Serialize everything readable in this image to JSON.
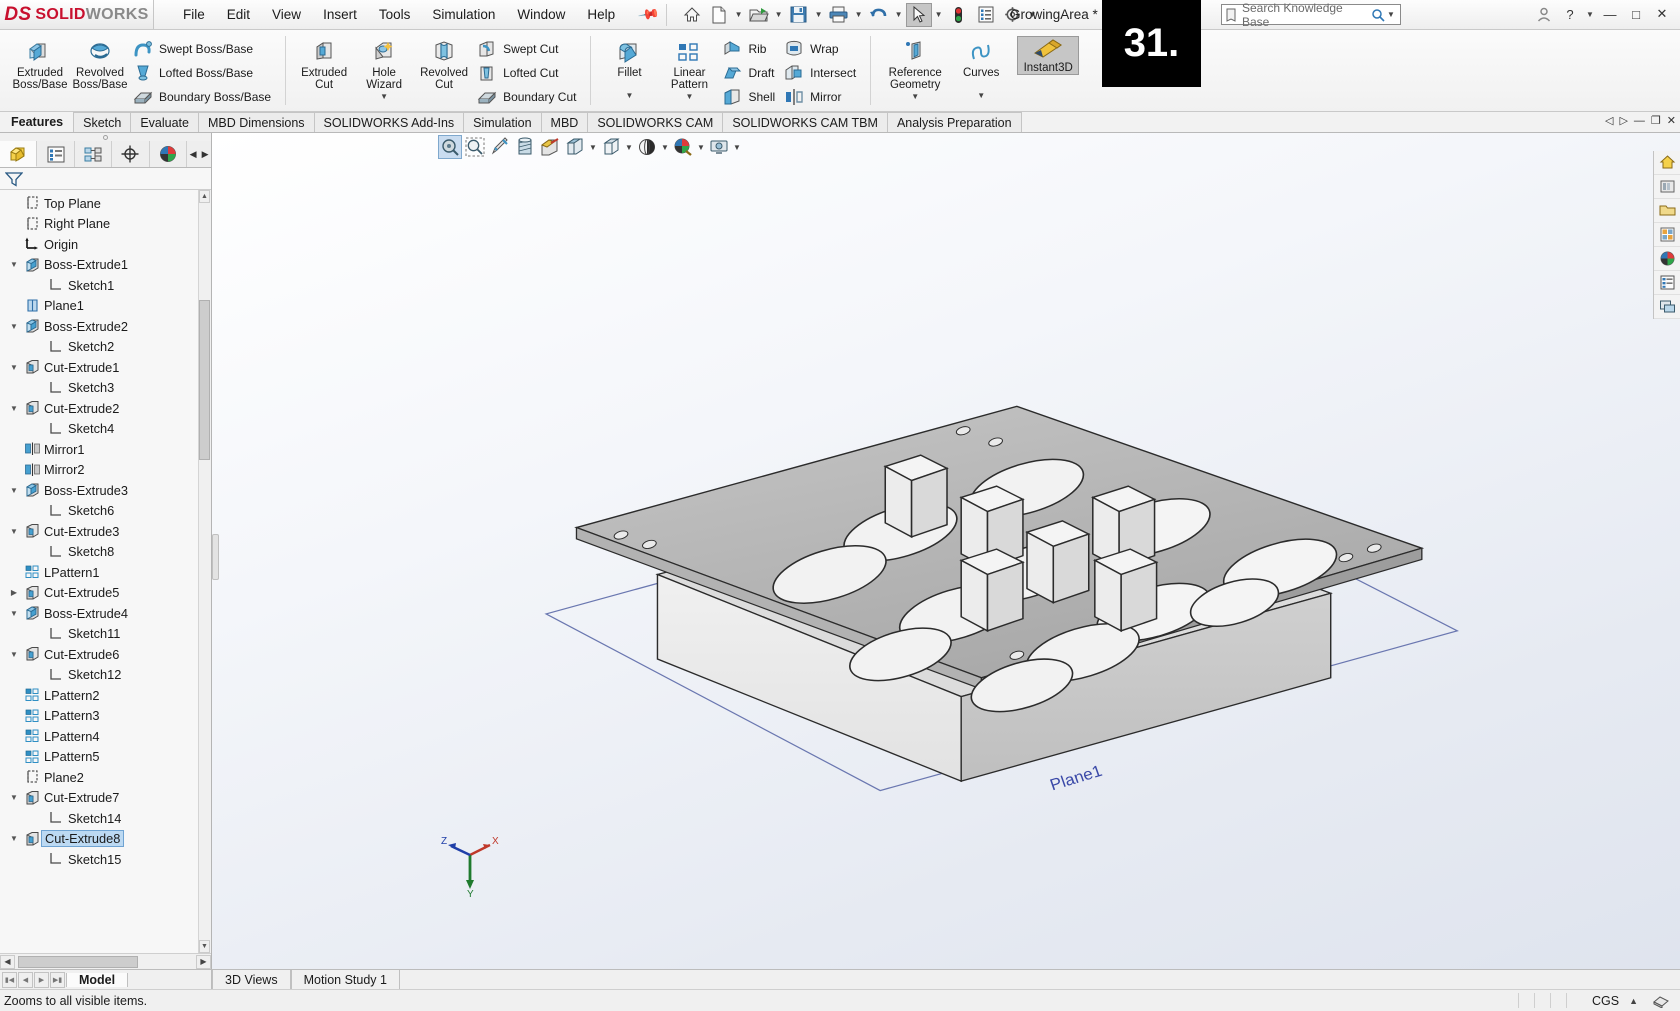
{
  "app": {
    "brand_ds": "DS",
    "brand_solid": "SOLID",
    "brand_works": "WORKS",
    "document_title": "GrowingArea *",
    "overlay_number": "31."
  },
  "menubar": {
    "items": [
      "File",
      "Edit",
      "View",
      "Insert",
      "Tools",
      "Simulation",
      "Window",
      "Help"
    ]
  },
  "quick_access": {
    "icons": [
      "home-icon",
      "new-document-icon",
      "open-folder-icon",
      "save-icon",
      "print-icon",
      "undo-icon",
      "select-cursor-icon",
      "rebuild-icon",
      "options-list-icon",
      "gear-icon"
    ]
  },
  "search": {
    "placeholder": "Search Knowledge Base",
    "icon": "knowledge-base-icon",
    "search_icon": "magnifier-icon"
  },
  "window_controls": {
    "account": "person-icon",
    "help": "?",
    "minimize": "minimize-icon",
    "maximize": "maximize-icon",
    "close": "close-icon"
  },
  "ribbon": {
    "groups": [
      {
        "name": "boss-base",
        "big": [
          {
            "label_line1": "Extruded",
            "label_line2": "Boss/Base",
            "icon": "extruded-boss-icon"
          },
          {
            "label_line1": "Revolved",
            "label_line2": "Boss/Base",
            "icon": "revolved-boss-icon"
          }
        ],
        "small": [
          {
            "label": "Swept Boss/Base",
            "icon": "swept-boss-icon"
          },
          {
            "label": "Lofted Boss/Base",
            "icon": "lofted-boss-icon"
          },
          {
            "label": "Boundary Boss/Base",
            "icon": "boundary-boss-icon"
          }
        ]
      },
      {
        "name": "cut",
        "big": [
          {
            "label_line1": "Extruded",
            "label_line2": "Cut",
            "icon": "extruded-cut-icon",
            "dropdown": false
          },
          {
            "label_line1": "Hole",
            "label_line2": "Wizard",
            "icon": "hole-wizard-icon",
            "dropdown": true
          },
          {
            "label_line1": "Revolved",
            "label_line2": "Cut",
            "icon": "revolved-cut-icon",
            "dropdown": false
          }
        ],
        "small": [
          {
            "label": "Swept Cut",
            "icon": "swept-cut-icon"
          },
          {
            "label": "Lofted Cut",
            "icon": "lofted-cut-icon"
          },
          {
            "label": "Boundary Cut",
            "icon": "boundary-cut-icon"
          }
        ]
      },
      {
        "name": "features",
        "big": [
          {
            "label_line1": "Fillet",
            "label_line2": "",
            "icon": "fillet-icon",
            "dropdown": true
          },
          {
            "label_line1": "Linear",
            "label_line2": "Pattern",
            "icon": "linear-pattern-icon",
            "dropdown": true
          }
        ],
        "small_a": [
          {
            "label": "Rib",
            "icon": "rib-icon"
          },
          {
            "label": "Draft",
            "icon": "draft-icon"
          },
          {
            "label": "Shell",
            "icon": "shell-icon"
          }
        ],
        "small_b": [
          {
            "label": "Wrap",
            "icon": "wrap-icon"
          },
          {
            "label": "Intersect",
            "icon": "intersect-icon"
          },
          {
            "label": "Mirror",
            "icon": "mirror-icon"
          }
        ]
      },
      {
        "name": "geometry",
        "big": [
          {
            "label_line1": "Reference",
            "label_line2": "Geometry",
            "icon": "reference-geometry-icon",
            "dropdown": true
          },
          {
            "label_line1": "Curves",
            "label_line2": "",
            "icon": "curves-icon",
            "dropdown": true
          }
        ]
      }
    ],
    "instant3d": {
      "label": "Instant3D",
      "icon": "instant3d-icon",
      "active": true
    }
  },
  "command_tabs": {
    "items": [
      {
        "label": "Features",
        "active": true
      },
      {
        "label": "Sketch",
        "active": false
      },
      {
        "label": "Evaluate",
        "active": false
      },
      {
        "label": "MBD Dimensions",
        "active": false
      },
      {
        "label": "SOLIDWORKS Add-Ins",
        "active": false
      },
      {
        "label": "Simulation",
        "active": false
      },
      {
        "label": "MBD",
        "active": false
      },
      {
        "label": "SOLIDWORKS CAM",
        "active": false
      },
      {
        "label": "SOLIDWORKS CAM TBM",
        "active": false
      },
      {
        "label": "Analysis Preparation",
        "active": false
      }
    ]
  },
  "feature_manager": {
    "tabs": [
      {
        "name": "feature-tree-tab",
        "icon": "feature-tree-icon",
        "active": true
      },
      {
        "name": "property-manager-tab",
        "icon": "property-manager-icon",
        "active": false
      },
      {
        "name": "configuration-manager-tab",
        "icon": "configuration-manager-icon",
        "active": false
      },
      {
        "name": "dimxpert-manager-tab",
        "icon": "dimxpert-icon",
        "active": false
      },
      {
        "name": "display-manager-tab",
        "icon": "appearance-sphere-icon",
        "active": false
      }
    ],
    "filter_icon": "filter-funnel-icon",
    "tree": [
      {
        "label": "Top Plane",
        "icon": "plane-icon",
        "indent": 1,
        "twist": "",
        "selected": false
      },
      {
        "label": "Right Plane",
        "icon": "plane-icon",
        "indent": 1,
        "twist": "",
        "selected": false
      },
      {
        "label": "Origin",
        "icon": "origin-icon",
        "indent": 1,
        "twist": "",
        "selected": false
      },
      {
        "label": "Boss-Extrude1",
        "icon": "boss-extrude-icon",
        "indent": 1,
        "twist": "down",
        "selected": false
      },
      {
        "label": "Sketch1",
        "icon": "sketch-icon",
        "indent": 2,
        "twist": "",
        "selected": false
      },
      {
        "label": "Plane1",
        "icon": "plane-blue-icon",
        "indent": 1,
        "twist": "",
        "selected": false
      },
      {
        "label": "Boss-Extrude2",
        "icon": "boss-extrude-icon",
        "indent": 1,
        "twist": "down",
        "selected": false
      },
      {
        "label": "Sketch2",
        "icon": "sketch-icon",
        "indent": 2,
        "twist": "",
        "selected": false
      },
      {
        "label": "Cut-Extrude1",
        "icon": "cut-extrude-icon",
        "indent": 1,
        "twist": "down",
        "selected": false
      },
      {
        "label": "Sketch3",
        "icon": "sketch-icon",
        "indent": 2,
        "twist": "",
        "selected": false
      },
      {
        "label": "Cut-Extrude2",
        "icon": "cut-extrude-icon",
        "indent": 1,
        "twist": "down",
        "selected": false
      },
      {
        "label": "Sketch4",
        "icon": "sketch-icon",
        "indent": 2,
        "twist": "",
        "selected": false
      },
      {
        "label": "Mirror1",
        "icon": "mirror-icon",
        "indent": 1,
        "twist": "",
        "selected": false
      },
      {
        "label": "Mirror2",
        "icon": "mirror-icon",
        "indent": 1,
        "twist": "",
        "selected": false
      },
      {
        "label": "Boss-Extrude3",
        "icon": "boss-extrude-icon",
        "indent": 1,
        "twist": "down",
        "selected": false
      },
      {
        "label": "Sketch6",
        "icon": "sketch-icon",
        "indent": 2,
        "twist": "",
        "selected": false
      },
      {
        "label": "Cut-Extrude3",
        "icon": "cut-extrude-icon",
        "indent": 1,
        "twist": "down",
        "selected": false
      },
      {
        "label": "Sketch8",
        "icon": "sketch-icon",
        "indent": 2,
        "twist": "",
        "selected": false
      },
      {
        "label": "LPattern1",
        "icon": "lpattern-icon",
        "indent": 1,
        "twist": "",
        "selected": false
      },
      {
        "label": "Cut-Extrude5",
        "icon": "cut-extrude-icon",
        "indent": 1,
        "twist": "right",
        "selected": false
      },
      {
        "label": "Boss-Extrude4",
        "icon": "boss-extrude-icon",
        "indent": 1,
        "twist": "down",
        "selected": false
      },
      {
        "label": "Sketch11",
        "icon": "sketch-icon",
        "indent": 2,
        "twist": "",
        "selected": false
      },
      {
        "label": "Cut-Extrude6",
        "icon": "cut-extrude-icon",
        "indent": 1,
        "twist": "down",
        "selected": false
      },
      {
        "label": "Sketch12",
        "icon": "sketch-icon",
        "indent": 2,
        "twist": "",
        "selected": false
      },
      {
        "label": "LPattern2",
        "icon": "lpattern-icon",
        "indent": 1,
        "twist": "",
        "selected": false
      },
      {
        "label": "LPattern3",
        "icon": "lpattern-icon",
        "indent": 1,
        "twist": "",
        "selected": false
      },
      {
        "label": "LPattern4",
        "icon": "lpattern-icon",
        "indent": 1,
        "twist": "",
        "selected": false
      },
      {
        "label": "LPattern5",
        "icon": "lpattern-icon",
        "indent": 1,
        "twist": "",
        "selected": false
      },
      {
        "label": "Plane2",
        "icon": "plane-icon",
        "indent": 1,
        "twist": "",
        "selected": false
      },
      {
        "label": "Cut-Extrude7",
        "icon": "cut-extrude-icon",
        "indent": 1,
        "twist": "down",
        "selected": false
      },
      {
        "label": "Sketch14",
        "icon": "sketch-icon",
        "indent": 2,
        "twist": "",
        "selected": false
      },
      {
        "label": "Cut-Extrude8",
        "icon": "cut-extrude-icon",
        "indent": 1,
        "twist": "down",
        "selected": true
      },
      {
        "label": "Sketch15",
        "icon": "sketch-icon",
        "indent": 2,
        "twist": "",
        "selected": false
      }
    ]
  },
  "view_toolbar": {
    "items": [
      {
        "name": "zoom-to-fit-button",
        "icon": "zoom-fit-icon",
        "active": true,
        "dropdown": false
      },
      {
        "name": "zoom-to-area-button",
        "icon": "zoom-area-icon",
        "active": false,
        "dropdown": false
      },
      {
        "name": "previous-view-button",
        "icon": "previous-view-icon",
        "active": false,
        "dropdown": false
      },
      {
        "name": "section-view-button",
        "icon": "section-view-icon",
        "active": false,
        "dropdown": false
      },
      {
        "name": "view-orientation-button",
        "icon": "view-orientation-icon",
        "active": false,
        "dropdown": false
      },
      {
        "name": "display-style-button",
        "icon": "display-style-icon",
        "active": false,
        "dropdown": true
      },
      {
        "name": "hide-show-items-button",
        "icon": "hide-show-icon",
        "active": false,
        "dropdown": true
      },
      {
        "name": "edit-appearance-button",
        "icon": "appearance-icon",
        "active": false,
        "dropdown": true
      },
      {
        "name": "apply-scene-button",
        "icon": "scene-icon",
        "active": false,
        "dropdown": true
      },
      {
        "name": "view-settings-button",
        "icon": "view-settings-icon",
        "active": false,
        "dropdown": true
      }
    ]
  },
  "right_dock": {
    "items": [
      {
        "name": "view-palette-home-icon"
      },
      {
        "name": "design-library-icon"
      },
      {
        "name": "file-explorer-icon"
      },
      {
        "name": "view-palette-icon"
      },
      {
        "name": "appearances-scenes-icon"
      },
      {
        "name": "custom-properties-icon"
      },
      {
        "name": "display-manager-panel-icon"
      }
    ]
  },
  "graphics": {
    "plane_label": "Plane1",
    "triad": {
      "x": "X",
      "y": "Y",
      "z": "Z"
    },
    "model_description": "isometric-plate-with-circular-holes-and-square-posts"
  },
  "bottom_tabs": {
    "nav_buttons": [
      "first-icon",
      "previous-icon",
      "next-icon",
      "last-icon"
    ],
    "items": [
      {
        "label": "Model",
        "active": true
      },
      {
        "label": "3D Views",
        "active": false
      },
      {
        "label": "Motion Study 1",
        "active": false
      }
    ]
  },
  "status_bar": {
    "message": "Zooms to all visible items.",
    "unit_system": "CGS",
    "unit_caret": "▲",
    "editing_icon": "editing-part-icon"
  },
  "colors": {
    "brand_red": "#c8102e",
    "selection_blue": "#bcd9f2",
    "plane_outline": "#5d6ea8",
    "model_face_top": "#bdbdbd",
    "model_face_light": "#eaeaea",
    "accent_blue": "#2f77b5"
  }
}
